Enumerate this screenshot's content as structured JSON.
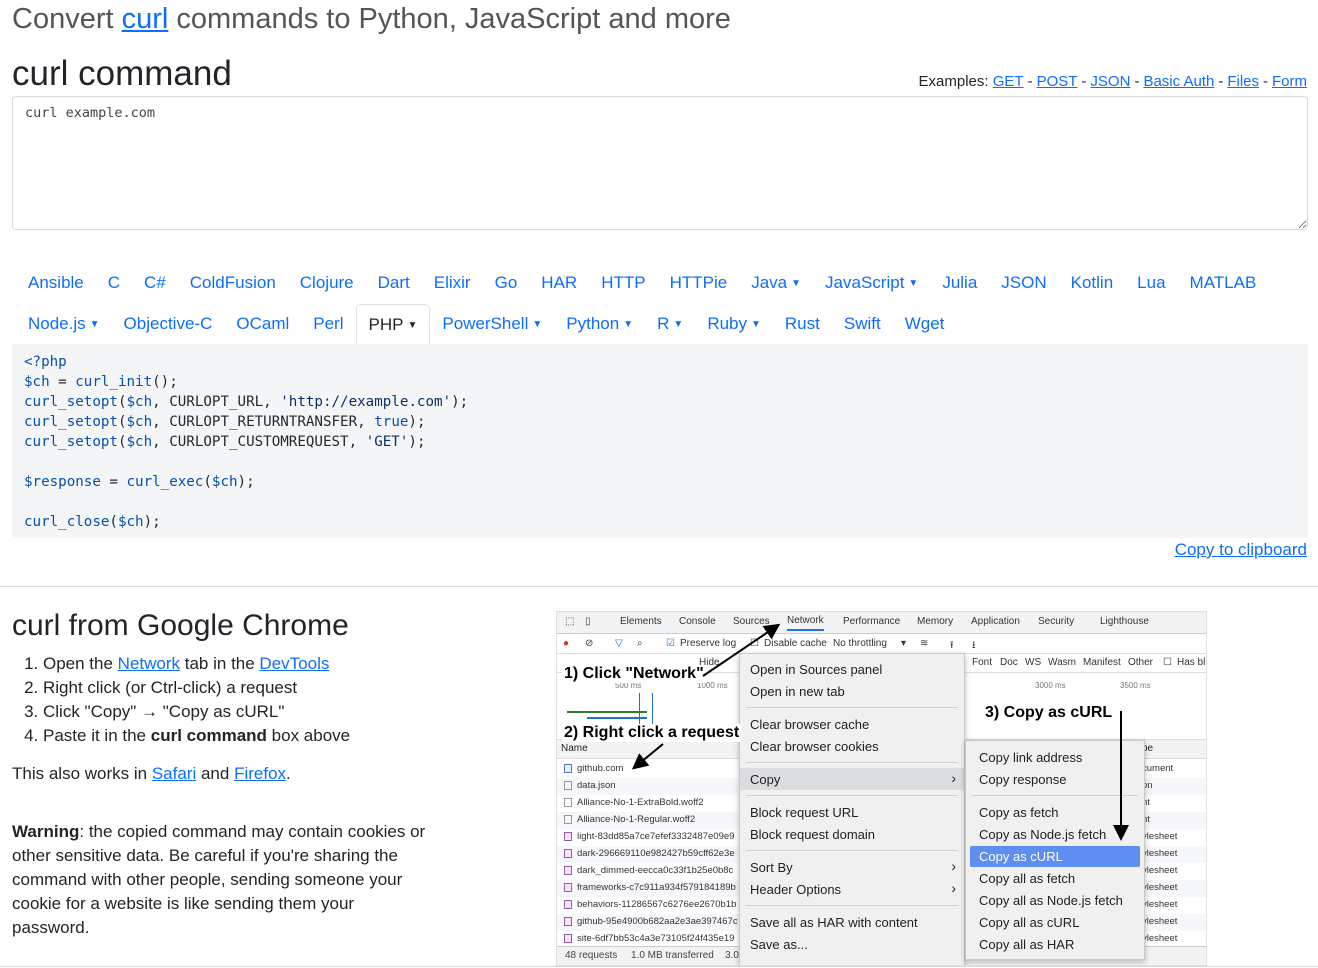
{
  "header": {
    "pre": "Convert ",
    "link": "curl",
    "post": " commands to Python, JavaScript and more"
  },
  "curl_command": {
    "title": "curl command",
    "examples_label": "Examples:",
    "examples": [
      "GET",
      "POST",
      "JSON",
      "Basic Auth",
      "Files",
      "Form"
    ],
    "input_value": "curl example.com"
  },
  "languages": {
    "row1": [
      {
        "label": "Ansible",
        "dropdown": false
      },
      {
        "label": "C",
        "dropdown": false
      },
      {
        "label": "C#",
        "dropdown": false
      },
      {
        "label": "ColdFusion",
        "dropdown": false
      },
      {
        "label": "Clojure",
        "dropdown": false
      },
      {
        "label": "Dart",
        "dropdown": false
      },
      {
        "label": "Elixir",
        "dropdown": false
      },
      {
        "label": "Go",
        "dropdown": false
      },
      {
        "label": "HAR",
        "dropdown": false
      },
      {
        "label": "HTTP",
        "dropdown": false
      },
      {
        "label": "HTTPie",
        "dropdown": false
      },
      {
        "label": "Java",
        "dropdown": true
      },
      {
        "label": "JavaScript",
        "dropdown": true
      },
      {
        "label": "Julia",
        "dropdown": false
      },
      {
        "label": "JSON",
        "dropdown": false
      },
      {
        "label": "Kotlin",
        "dropdown": false
      },
      {
        "label": "Lua",
        "dropdown": false
      },
      {
        "label": "MATLAB",
        "dropdown": false
      }
    ],
    "row2": [
      {
        "label": "Node.js",
        "dropdown": true
      },
      {
        "label": "Objective-C",
        "dropdown": false
      },
      {
        "label": "OCaml",
        "dropdown": false
      },
      {
        "label": "Perl",
        "dropdown": false
      },
      {
        "label": "PHP",
        "dropdown": true,
        "active": true
      },
      {
        "label": "PowerShell",
        "dropdown": true
      },
      {
        "label": "Python",
        "dropdown": true
      },
      {
        "label": "R",
        "dropdown": true
      },
      {
        "label": "Ruby",
        "dropdown": true
      },
      {
        "label": "Rust",
        "dropdown": false
      },
      {
        "label": "Swift",
        "dropdown": false
      },
      {
        "label": "Wget",
        "dropdown": false
      }
    ]
  },
  "code": {
    "lines": [
      "<?php",
      "$ch = curl_init();",
      "curl_setopt($ch, CURLOPT_URL, 'http://example.com');",
      "curl_setopt($ch, CURLOPT_RETURNTRANSFER, true);",
      "curl_setopt($ch, CURLOPT_CUSTOMREQUEST, 'GET');",
      "",
      "$response = curl_exec($ch);",
      "",
      "curl_close($ch);"
    ],
    "copy_label": "Copy to clipboard"
  },
  "chrome": {
    "title": "curl from Google Chrome",
    "step1_pre": "Open the ",
    "step1_link1": "Network",
    "step1_mid": " tab in the ",
    "step1_link2": "DevTools",
    "step2": "Right click (or Ctrl-click) a request",
    "step3": "Click \"Copy\" → \"Copy as cURL\"",
    "step4_pre": "Paste it in the ",
    "step4_bold": "curl command",
    "step4_post": " box above",
    "also_pre": "This also works in ",
    "also_link1": "Safari",
    "also_mid": " and ",
    "also_link2": "Firefox",
    "also_post": ".",
    "warning_bold": "Warning",
    "warning_text": ": the copied command may contain cookies or other sensitive data. Be careful if you're sharing the command with other people, sending someone your cookie for a website is like sending them your password."
  },
  "devtools": {
    "tabs": [
      "Elements",
      "Console",
      "Sources",
      "Network",
      "Performance",
      "Memory",
      "Application",
      "Security",
      "Lighthouse"
    ],
    "toolbar": {
      "preserve_log": "Preserve log",
      "disable_cache": "Disable cache",
      "throttling": "No throttling"
    },
    "filter_items": [
      "Hide",
      "Font",
      "Doc",
      "WS",
      "Wasm",
      "Manifest",
      "Other",
      "Has bl"
    ],
    "timeline": {
      "t1": "500 ms",
      "t2": "1000 ms",
      "t3": "3000 ms",
      "t4": "3500 ms"
    },
    "name_header": "Name",
    "type_header": "pe",
    "rows": [
      {
        "name": "github.com",
        "type": "cument",
        "icon": "doc"
      },
      {
        "name": "data.json",
        "type": "on",
        "icon": "file"
      },
      {
        "name": "Alliance-No-1-ExtraBold.woff2",
        "type": "nt",
        "icon": "file"
      },
      {
        "name": "Alliance-No-1-Regular.woff2",
        "type": "nt",
        "icon": "file"
      },
      {
        "name": "light-83dd85a7ce7efef3332487e09e9",
        "type": "ylesheet",
        "icon": "css"
      },
      {
        "name": "dark-296669110e982427b59cff62e3e",
        "type": "ylesheet",
        "icon": "css"
      },
      {
        "name": "dark_dimmed-eecca0c33f1b25e0b8c",
        "type": "ylesheet",
        "icon": "css"
      },
      {
        "name": "frameworks-c7c911a934f579184189b",
        "type": "ylesheet",
        "icon": "css"
      },
      {
        "name": "behaviors-11286567c6276ee2670b1b",
        "type": "ylesheet",
        "icon": "css"
      },
      {
        "name": "github-95e4900b682aa2e3ae397467c",
        "type": "ylesheet",
        "icon": "css"
      },
      {
        "name": "site-6df7bb53c4a3e73105f24f435e19",
        "type": "ylesheet",
        "icon": "css"
      }
    ],
    "footer": {
      "requests": "48 requests",
      "transferred": "1.0 MB transferred",
      "extra": "3.0"
    },
    "menu1": {
      "open_sources": "Open in Sources panel",
      "open_tab": "Open in new tab",
      "clear_cache": "Clear browser cache",
      "clear_cookies": "Clear browser cookies",
      "copy": "Copy",
      "block_url": "Block request URL",
      "block_domain": "Block request domain",
      "sort_by": "Sort By",
      "header_options": "Header Options",
      "save_har": "Save all as HAR with content",
      "save_as": "Save as..."
    },
    "menu2": {
      "copy_link": "Copy link address",
      "copy_response": "Copy response",
      "copy_fetch": "Copy as fetch",
      "copy_node_fetch": "Copy as Node.js fetch",
      "copy_curl": "Copy as cURL",
      "copy_all_fetch": "Copy all as fetch",
      "copy_all_node_fetch": "Copy all as Node.js fetch",
      "copy_all_curl": "Copy all as cURL",
      "copy_all_har": "Copy all as HAR"
    },
    "annotations": {
      "a1": "1) Click \"Network\"",
      "a2": "2) Right click a request",
      "a3": "3) Copy as cURL"
    }
  }
}
